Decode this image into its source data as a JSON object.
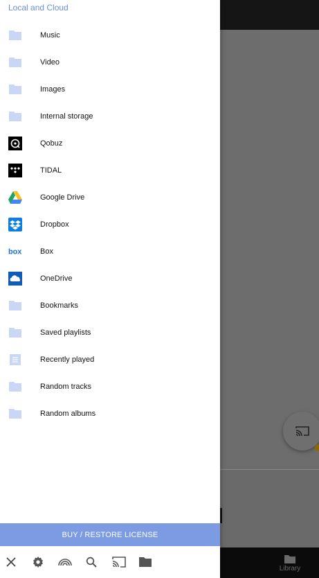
{
  "drawer": {
    "header": "Local and Cloud",
    "items": [
      {
        "label": "Music",
        "icon": "folder-icon"
      },
      {
        "label": "Video",
        "icon": "folder-icon"
      },
      {
        "label": "Images",
        "icon": "folder-icon"
      },
      {
        "label": "Internal storage",
        "icon": "folder-icon"
      },
      {
        "label": "Qobuz",
        "icon": "qobuz-icon"
      },
      {
        "label": "TIDAL",
        "icon": "tidal-icon"
      },
      {
        "label": "Google Drive",
        "icon": "google-drive-icon"
      },
      {
        "label": "Dropbox",
        "icon": "dropbox-icon"
      },
      {
        "label": "Box",
        "icon": "box-icon"
      },
      {
        "label": "OneDrive",
        "icon": "onedrive-icon"
      },
      {
        "label": "Bookmarks",
        "icon": "folder-icon"
      },
      {
        "label": "Saved playlists",
        "icon": "folder-icon"
      },
      {
        "label": "Recently played",
        "icon": "list-icon"
      },
      {
        "label": "Random tracks",
        "icon": "folder-icon"
      },
      {
        "label": "Random albums",
        "icon": "folder-icon"
      }
    ],
    "license_button": "BUY / RESTORE LICENSE",
    "toolbar": [
      "close-icon",
      "settings-icon",
      "network-icon",
      "search-icon",
      "cast-icon",
      "folder-icon"
    ]
  },
  "background": {
    "bottom_nav_label": "Library"
  },
  "colors": {
    "accent": "#7d9be2",
    "header_text": "#6b8fd9",
    "folder": "#c9d6f5"
  }
}
